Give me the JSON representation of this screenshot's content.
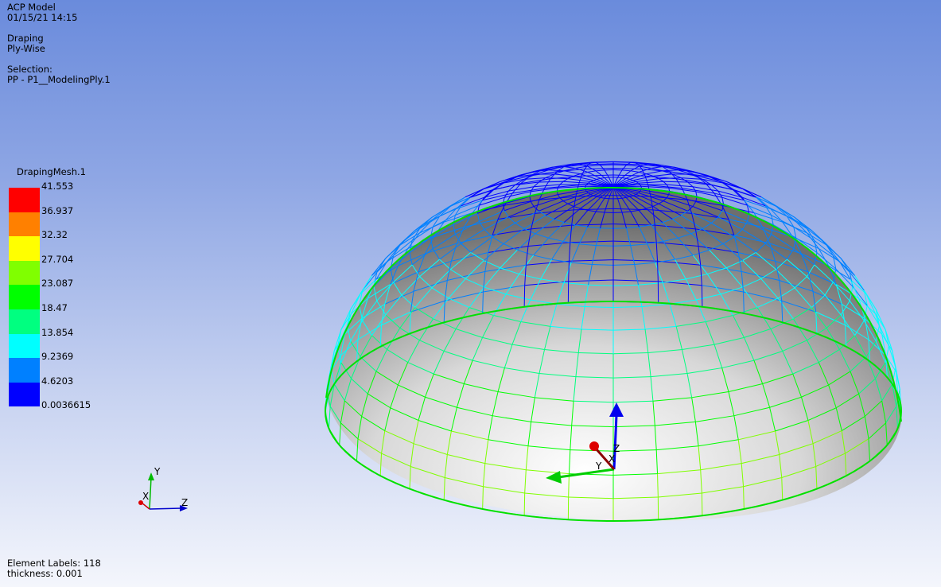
{
  "header": {
    "model": "ACP Model",
    "datetime": "01/15/21 14:15",
    "mode": "Draping",
    "submode": "Ply-Wise",
    "selection_label": "Selection:",
    "selection_value": "PP - P1__ModelingPly.1"
  },
  "legend": {
    "title": "DrapingMesh.1",
    "values": [
      "41.553",
      "36.937",
      "32.32",
      "27.704",
      "23.087",
      "18.47",
      "13.854",
      "9.2369",
      "4.6203",
      "0.0036615"
    ],
    "colors": [
      "#ff0000",
      "#ff8000",
      "#ffff00",
      "#80ff00",
      "#00ff00",
      "#00ff80",
      "#00ffff",
      "#0080ff",
      "#0000ff"
    ]
  },
  "triad": {
    "x": "X",
    "y": "Y",
    "z": "Z"
  },
  "model_axes": {
    "x": "X",
    "y": "Y",
    "z": "Z"
  },
  "footer": {
    "element_labels": "Element Labels: 118",
    "thickness": "thickness: 0.001"
  }
}
